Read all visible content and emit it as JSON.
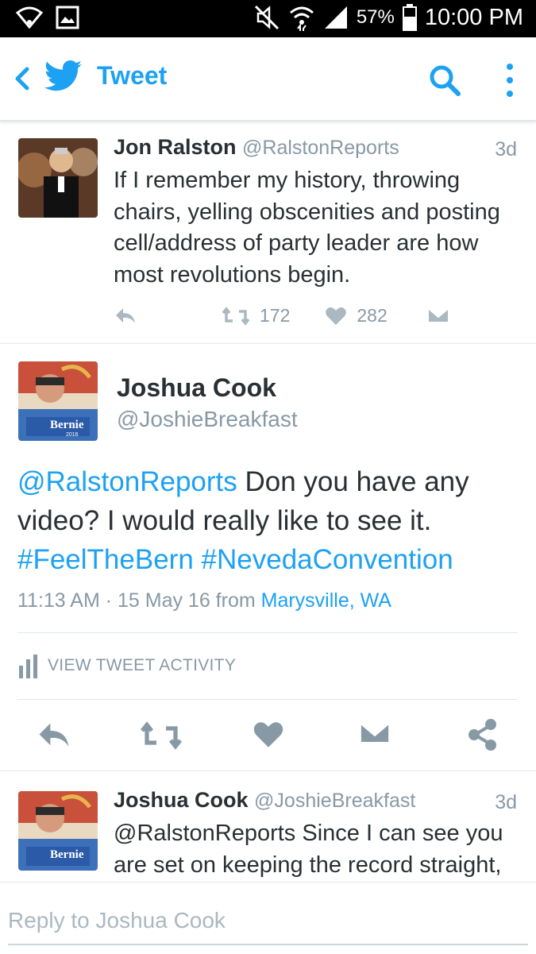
{
  "status_bar": {
    "battery": "57%",
    "time": "10:00 PM"
  },
  "app_bar": {
    "title": "Tweet"
  },
  "tweets": [
    {
      "name": "Jon Ralston",
      "handle": "@RalstonReports",
      "age": "3d",
      "text": "If I remember my history, throwing chairs, yelling obscenities and posting cell/address of party leader are how most revolutions begin.",
      "retweets": "172",
      "likes": "282"
    }
  ],
  "main_tweet": {
    "name": "Joshua Cook",
    "handle": "@JoshieBreakfast",
    "avatar_text": "Bernie",
    "avatar_year": "2016",
    "text_mention": "@RalstonReports",
    "text_body": " Don you have any video? I would really like to see it.",
    "hashtag_1": "#FeelTheBern",
    "hashtag_2": "#NevedaConvention",
    "timestamp": "11:13 AM · 15 May 16 from ",
    "location": "Marysville, WA",
    "activity_label": "VIEW TWEET ACTIVITY"
  },
  "reply_tweet": {
    "name": "Joshua Cook",
    "handle": "@JoshieBreakfast",
    "age": "3d",
    "text": "@RalstonReports Since I can see you are set on keeping the record straight,"
  },
  "reply_input": {
    "placeholder": "Reply to Joshua Cook"
  },
  "colors": {
    "accent": "#1da1f2",
    "muted": "#8899a6",
    "text": "#292f33"
  }
}
